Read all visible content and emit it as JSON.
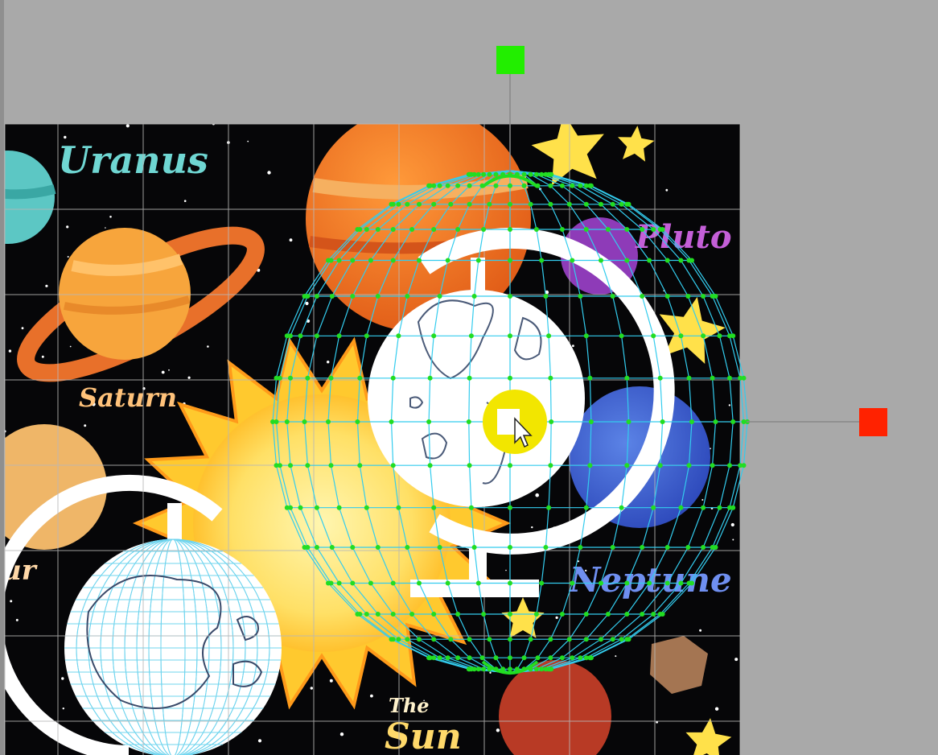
{
  "canvas": {
    "background": "#060608",
    "workspace_color": "#a9a9a9"
  },
  "planets": {
    "uranus": "Uranus",
    "saturn": "Saturn",
    "pluto": "Pluto",
    "neptune": "Neptune",
    "sun_the": "The",
    "sun_sun": "Sun",
    "partial_left": "ur"
  },
  "colors": {
    "mesh_points": "#22dd22",
    "mesh_lines": "#33ccee",
    "rotate_handle": "#22ee00",
    "scale_handle": "#ff2200",
    "pivot": "#f2e600",
    "grid": "#b8b8b8"
  },
  "icons": {
    "cursor": "arrow-cursor-icon",
    "rotate": "rotate-handle-icon",
    "scale": "scale-handle-icon"
  }
}
